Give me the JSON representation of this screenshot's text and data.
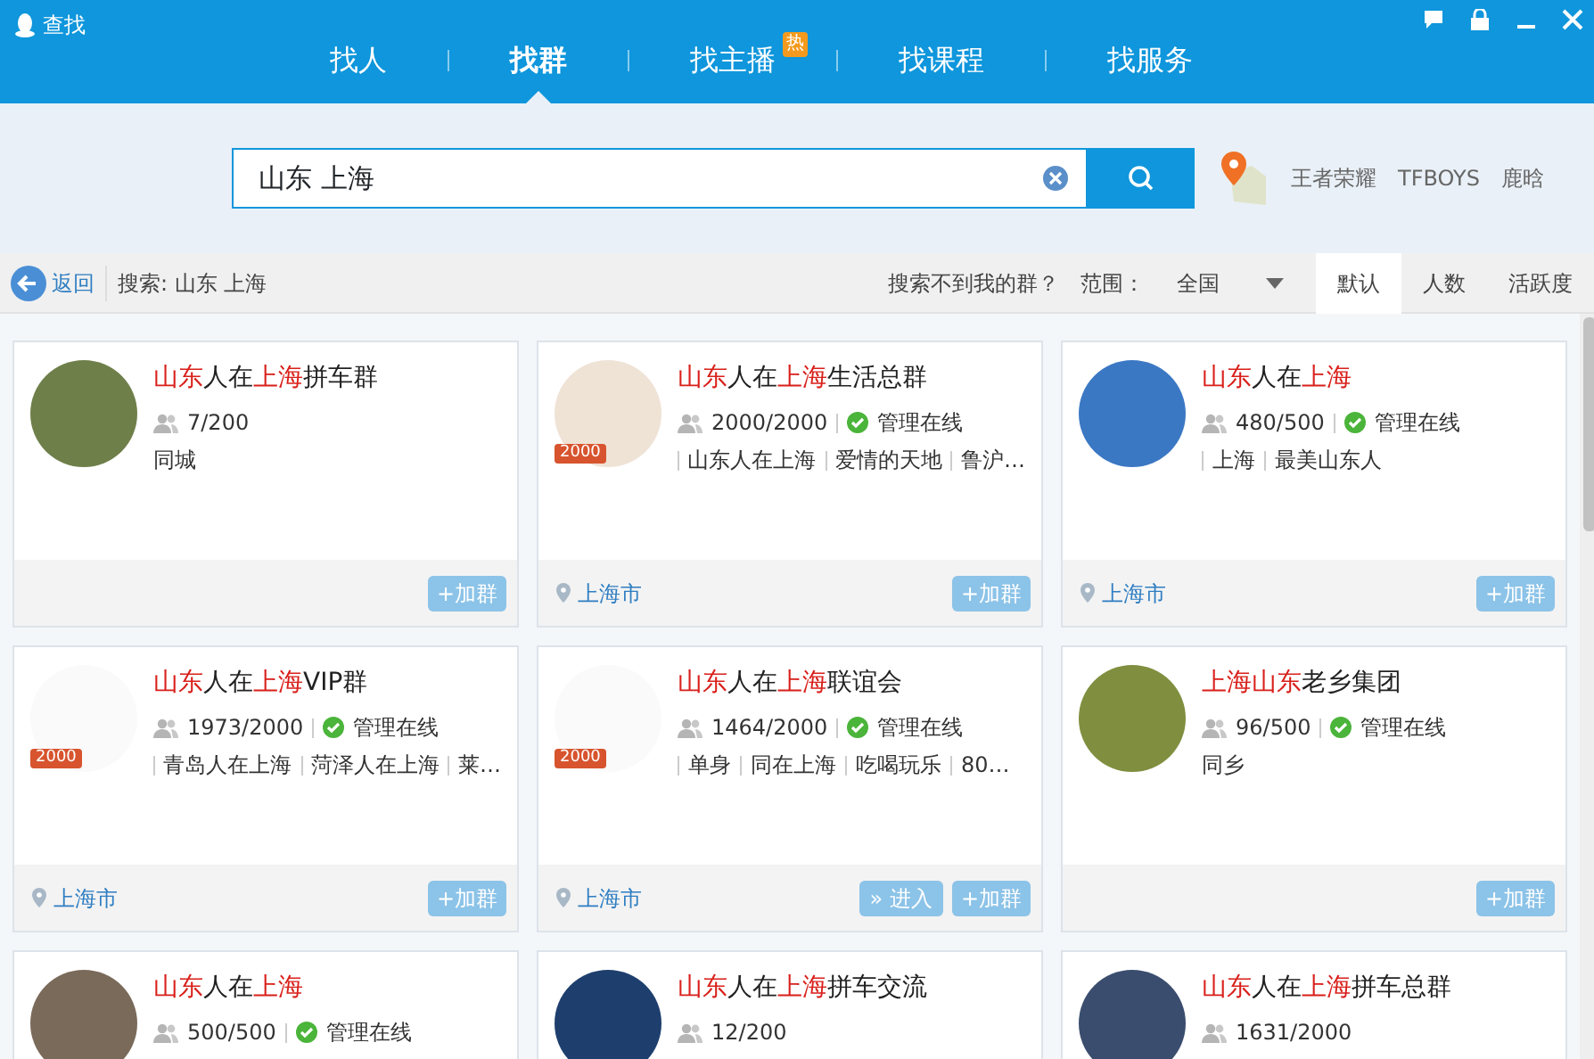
{
  "window": {
    "title": "查找"
  },
  "tabs": [
    {
      "label": "找人",
      "selected": false
    },
    {
      "label": "找群",
      "selected": true
    },
    {
      "label": "找主播",
      "selected": false,
      "badge": "热"
    },
    {
      "label": "找课程",
      "selected": false
    },
    {
      "label": "找服务",
      "selected": false
    }
  ],
  "search": {
    "value": "山东 上海"
  },
  "hot_keywords": [
    "王者荣耀",
    "TFBOYS",
    "鹿晗"
  ],
  "toolbar": {
    "back": "返回",
    "query": "搜索: 山东 上海",
    "not_found": "搜索不到我的群？",
    "scope_label": "范围：",
    "scope_value": "全国",
    "sorts": [
      {
        "label": "默认",
        "selected": true
      },
      {
        "label": "人数",
        "selected": false
      },
      {
        "label": "活跃度",
        "selected": false
      }
    ]
  },
  "groups": [
    {
      "title": [
        {
          "text": "山东",
          "highlight": true
        },
        {
          "text": "人在",
          "highlight": false
        },
        {
          "text": "上海",
          "highlight": true
        },
        {
          "text": "拼车群",
          "highlight": false
        }
      ],
      "members": "7/200",
      "admin_online": false,
      "tags": [
        "同城"
      ],
      "buttons": [
        {
          "kind": "join",
          "label": "+加群"
        }
      ]
    },
    {
      "title": [
        {
          "text": "山东",
          "highlight": true
        },
        {
          "text": "人在",
          "highlight": false
        },
        {
          "text": "上海",
          "highlight": true
        },
        {
          "text": "生活总群",
          "highlight": false
        }
      ],
      "badge": "2000",
      "members": "2000/2000",
      "admin_online": true,
      "admin_label": "管理在线",
      "tags": [
        "山东人在上海",
        "爱情的天地",
        "鲁沪…"
      ],
      "location": "上海市",
      "buttons": [
        {
          "kind": "join",
          "label": "+加群"
        }
      ]
    },
    {
      "title": [
        {
          "text": "山东",
          "highlight": true
        },
        {
          "text": "人在",
          "highlight": false
        },
        {
          "text": "上海",
          "highlight": true
        }
      ],
      "members": "480/500",
      "admin_online": true,
      "admin_label": "管理在线",
      "tags": [
        "上海",
        "最美山东人"
      ],
      "location": "上海市",
      "buttons": [
        {
          "kind": "join",
          "label": "+加群"
        }
      ]
    },
    {
      "title": [
        {
          "text": "山东",
          "highlight": true
        },
        {
          "text": "人在",
          "highlight": false
        },
        {
          "text": "上海",
          "highlight": true
        },
        {
          "text": "VIP群",
          "highlight": false
        }
      ],
      "badge": "2000",
      "members": "1973/2000",
      "admin_online": true,
      "admin_label": "管理在线",
      "tags": [
        "青岛人在上海",
        "菏泽人在上海",
        "莱…"
      ],
      "location": "上海市",
      "buttons": [
        {
          "kind": "join",
          "label": "+加群"
        }
      ]
    },
    {
      "title": [
        {
          "text": "山东",
          "highlight": true
        },
        {
          "text": "人在",
          "highlight": false
        },
        {
          "text": "上海",
          "highlight": true
        },
        {
          "text": "联谊会",
          "highlight": false
        }
      ],
      "badge": "2000",
      "members": "1464/2000",
      "admin_online": true,
      "admin_label": "管理在线",
      "tags": [
        "单身",
        "同在上海",
        "吃喝玩乐",
        "80…"
      ],
      "location": "上海市",
      "buttons": [
        {
          "kind": "enter",
          "label": "» 进入"
        },
        {
          "kind": "join",
          "label": "+加群"
        }
      ]
    },
    {
      "title": [
        {
          "text": "上海",
          "highlight": true
        },
        {
          "text": "山东",
          "highlight": true
        },
        {
          "text": "老乡集团",
          "highlight": false
        }
      ],
      "members": "96/500",
      "admin_online": true,
      "admin_label": "管理在线",
      "tags": [
        "同乡"
      ],
      "buttons": [
        {
          "kind": "join",
          "label": "+加群"
        }
      ]
    },
    {
      "title": [
        {
          "text": "山东",
          "highlight": true
        },
        {
          "text": "人在",
          "highlight": false
        },
        {
          "text": "上海",
          "highlight": true
        }
      ],
      "members": "500/500",
      "admin_online": true,
      "admin_label": "管理在线"
    },
    {
      "title": [
        {
          "text": "山东",
          "highlight": true
        },
        {
          "text": "人在",
          "highlight": false
        },
        {
          "text": "上海",
          "highlight": true
        },
        {
          "text": "拼车交流",
          "highlight": false
        }
      ],
      "members": "12/200",
      "admin_online": false
    },
    {
      "title": [
        {
          "text": "山东",
          "highlight": true
        },
        {
          "text": "人在",
          "highlight": false
        },
        {
          "text": "上海",
          "highlight": true
        },
        {
          "text": "拼车总群",
          "highlight": false
        }
      ],
      "members": "1631/2000",
      "admin_online": false
    }
  ]
}
